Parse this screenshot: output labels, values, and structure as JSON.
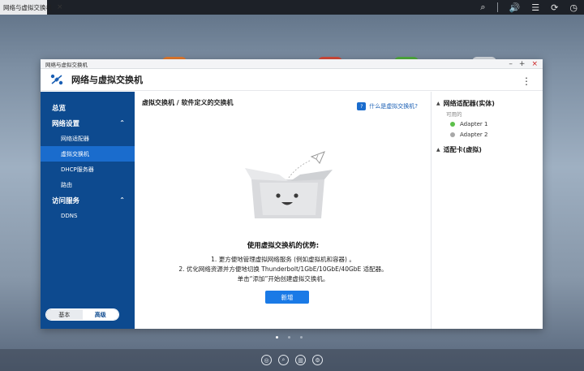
{
  "taskbar": {
    "tab_title": "网络与虚拟交换机",
    "tab_close": "×",
    "tray": {
      "search_icon": "⌕",
      "volume_icon": "🔊",
      "stack_icon": "☰",
      "sync_icon": "⟳",
      "time_icon": "◷"
    }
  },
  "window": {
    "titlebar_text": "网络与虚拟交换机",
    "ctrl_min": "–",
    "ctrl_max": "+",
    "ctrl_close": "×",
    "app_title": "网络与虚拟交换机",
    "more_icon": "⋮"
  },
  "sidebar": {
    "items": [
      {
        "label": "总览",
        "level": "top"
      },
      {
        "label": "网络设置",
        "level": "top",
        "chevron": "⌃"
      },
      {
        "label": "网络适配器",
        "level": "sub"
      },
      {
        "label": "虚拟交换机",
        "level": "sub",
        "active": true
      },
      {
        "label": "DHCP服务器",
        "level": "sub"
      },
      {
        "label": "路由",
        "level": "sub"
      },
      {
        "label": "访问服务",
        "level": "top",
        "chevron": "⌃"
      },
      {
        "label": "DDNS",
        "level": "sub"
      }
    ],
    "mode_basic": "基本",
    "mode_advanced": "高级"
  },
  "main": {
    "breadcrumb": "虚拟交换机 / 软件定义的交换机",
    "help_icon": "?",
    "help_link": "什么是虚拟交换机?",
    "benefits_title": "使用虚拟交换机的优势:",
    "benefit_1": "1. 更方便地管理虚拟网络服务 (例如虚拟机和容器) 。",
    "benefit_2": "2. 优化网络资源并方便地切换 Thunderbolt/1GbE/10GbE/40GbE 适配器。",
    "benefit_3": "单击“添加”开始创建虚拟交换机。",
    "add_button": "新增"
  },
  "right_panel": {
    "network_adapters_title": "网络适配器(实体)",
    "available_label": "可用的",
    "adapters": [
      {
        "name": "Adapter 1",
        "status_color": "#5cc04a"
      },
      {
        "name": "Adapter 2",
        "status_color": "#a8a8a8"
      }
    ],
    "wifi_title": "适配卡(虚拟)",
    "caret": "▲"
  },
  "colors": {
    "sidebar_bg": "#0d4a8f",
    "sidebar_active": "#1a6ccd",
    "accent_button": "#1a7ae6"
  }
}
